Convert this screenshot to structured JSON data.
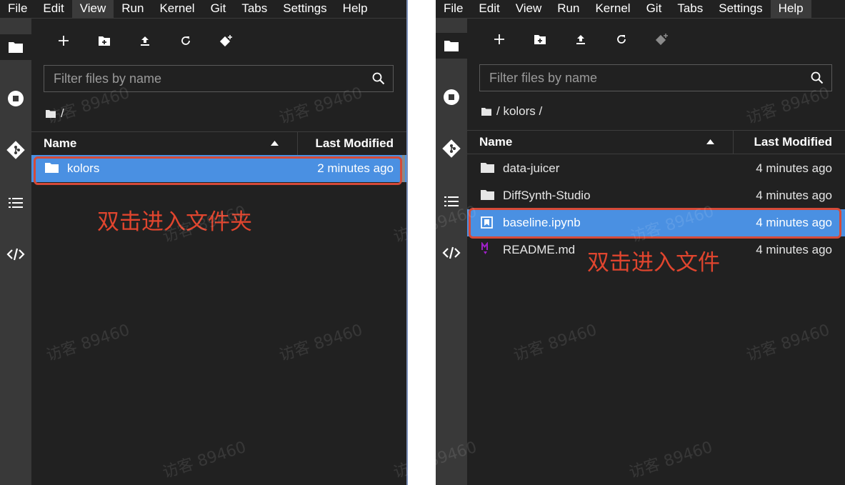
{
  "menu": [
    "File",
    "Edit",
    "View",
    "Run",
    "Kernel",
    "Git",
    "Tabs",
    "Settings",
    "Help"
  ],
  "left": {
    "active_menu": "View",
    "filter_placeholder": "Filter files by name",
    "breadcrumb": "/",
    "columns": {
      "name": "Name",
      "modified": "Last Modified"
    },
    "files": [
      {
        "name": "kolors",
        "modified": "2 minutes ago",
        "icon": "folder-icon",
        "selected": true
      }
    ],
    "annotation": "双击进入文件夹"
  },
  "right": {
    "active_menu": "Help",
    "filter_placeholder": "Filter files by name",
    "breadcrumb": "/ kolors /",
    "columns": {
      "name": "Name",
      "modified": "Last Modified"
    },
    "files": [
      {
        "name": "data-juicer",
        "modified": "4 minutes ago",
        "icon": "folder-icon",
        "selected": false
      },
      {
        "name": "DiffSynth-Studio",
        "modified": "4 minutes ago",
        "icon": "folder-icon",
        "selected": false
      },
      {
        "name": "baseline.ipynb",
        "modified": "4 minutes ago",
        "icon": "notebook-icon",
        "selected": true
      },
      {
        "name": "README.md",
        "modified": "4 minutes ago",
        "icon": "markdown-icon",
        "selected": false
      }
    ],
    "annotation": "双击进入文件"
  },
  "watermark": "访客 89460",
  "colors": {
    "background": "#212121",
    "sidebar": "#393939",
    "selection": "#4a90e2",
    "annotation": "#e0452e"
  }
}
